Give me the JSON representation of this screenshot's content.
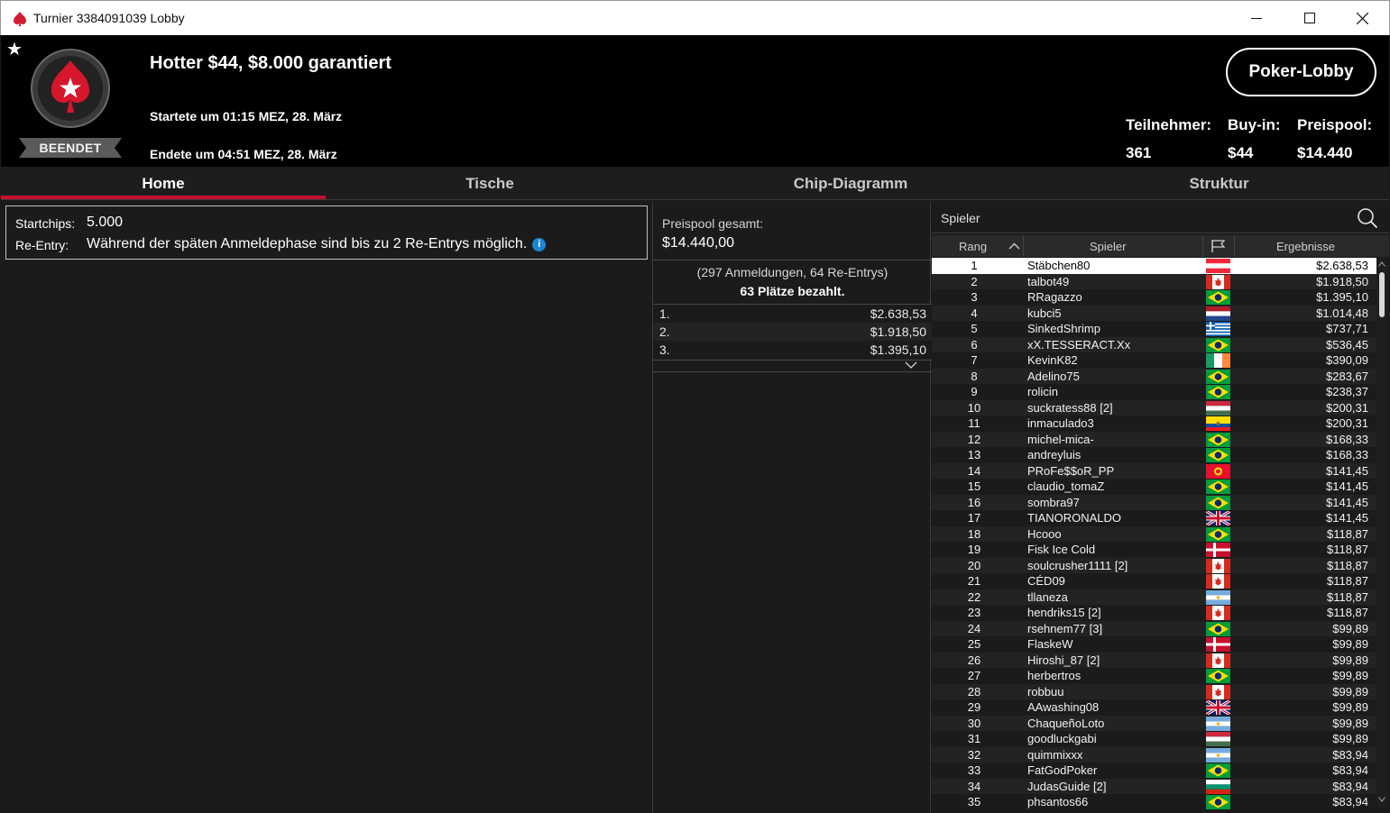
{
  "window": {
    "title": "Turnier 3384091039 Lobby"
  },
  "header": {
    "tournament_name": "Hotter $44, $8.000 garantiert",
    "started": "Startete um 01:15 MEZ, 28. März",
    "ended": "Endete um 04:51 MEZ, 28. März",
    "status": "BEENDET",
    "lobby_button": "Poker-Lobby",
    "stats": [
      {
        "label": "Teilnehmer:",
        "value": "361"
      },
      {
        "label": "Buy-in:",
        "value": "$44"
      },
      {
        "label": "Preispool:",
        "value": "$14.440"
      }
    ]
  },
  "tabs": [
    {
      "label": "Home",
      "active": true
    },
    {
      "label": "Tische",
      "active": false
    },
    {
      "label": "Chip-Diagramm",
      "active": false
    },
    {
      "label": "Struktur",
      "active": false
    }
  ],
  "info": {
    "startchips_label": "Startchips:",
    "startchips_value": "5.000",
    "reentry_label": "Re-Entry:",
    "reentry_value": "Während der späten Anmeldephase sind bis zu 2 Re-Entrys möglich.",
    "info_icon_glyph": "i"
  },
  "prizepool": {
    "label": "Preispool gesamt:",
    "total": "$14.440,00",
    "entries": "(297 Anmeldungen, 64 Re-Entrys)",
    "paid": "63 Plätze bezahlt.",
    "payouts": [
      {
        "place": "1.",
        "amount": "$2.638,53"
      },
      {
        "place": "2.",
        "amount": "$1.918,50"
      },
      {
        "place": "3.",
        "amount": "$1.395,10"
      }
    ]
  },
  "players": {
    "search_label": "Spieler",
    "columns": {
      "rank": "Rang",
      "player": "Spieler",
      "result": "Ergebnisse"
    },
    "rows": [
      {
        "rank": "1",
        "name": "Stäbchen80",
        "flag": "austria",
        "amount": "$2.638,53"
      },
      {
        "rank": "2",
        "name": "talbot49",
        "flag": "canada",
        "amount": "$1.918,50"
      },
      {
        "rank": "3",
        "name": "RRagazzo",
        "flag": "brazil",
        "amount": "$1.395,10"
      },
      {
        "rank": "4",
        "name": "kubci5",
        "flag": "netherlands",
        "amount": "$1.014,48"
      },
      {
        "rank": "5",
        "name": "SinkedShrimp",
        "flag": "greece",
        "amount": "$737,71"
      },
      {
        "rank": "6",
        "name": "xX.TESSERACT.Xx",
        "flag": "brazil",
        "amount": "$536,45"
      },
      {
        "rank": "7",
        "name": "KevinK82",
        "flag": "ireland",
        "amount": "$390,09"
      },
      {
        "rank": "8",
        "name": "Adelino75",
        "flag": "brazil",
        "amount": "$283,67"
      },
      {
        "rank": "9",
        "name": "rolicin",
        "flag": "brazil",
        "amount": "$238,37"
      },
      {
        "rank": "10",
        "name": "suckratess88 [2]",
        "flag": "hungary",
        "amount": "$200,31"
      },
      {
        "rank": "11",
        "name": "inmaculado3",
        "flag": "ecuador",
        "amount": "$200,31"
      },
      {
        "rank": "12",
        "name": "michel-mica-",
        "flag": "brazil",
        "amount": "$168,33"
      },
      {
        "rank": "13",
        "name": "andreyluis",
        "flag": "brazil",
        "amount": "$168,33"
      },
      {
        "rank": "14",
        "name": "PRoFe$$oR_PP",
        "flag": "kyrgyzstan",
        "amount": "$141,45"
      },
      {
        "rank": "15",
        "name": "claudio_tomaZ",
        "flag": "brazil",
        "amount": "$141,45"
      },
      {
        "rank": "16",
        "name": "sombra97",
        "flag": "brazil",
        "amount": "$141,45"
      },
      {
        "rank": "17",
        "name": "TIANORONALDO",
        "flag": "uk",
        "amount": "$141,45"
      },
      {
        "rank": "18",
        "name": "Hcooo",
        "flag": "brazil",
        "amount": "$118,87"
      },
      {
        "rank": "19",
        "name": "Fisk Ice Cold",
        "flag": "denmark",
        "amount": "$118,87"
      },
      {
        "rank": "20",
        "name": "soulcrusher1111 [2]",
        "flag": "canada",
        "amount": "$118,87"
      },
      {
        "rank": "21",
        "name": "CÉD09",
        "flag": "canada",
        "amount": "$118,87"
      },
      {
        "rank": "22",
        "name": "tllaneza",
        "flag": "argentina",
        "amount": "$118,87"
      },
      {
        "rank": "23",
        "name": "hendriks15 [2]",
        "flag": "canada",
        "amount": "$118,87"
      },
      {
        "rank": "24",
        "name": "rsehnem77 [3]",
        "flag": "brazil",
        "amount": "$99,89"
      },
      {
        "rank": "25",
        "name": "FlaskeW",
        "flag": "denmark",
        "amount": "$99,89"
      },
      {
        "rank": "26",
        "name": "Hiroshi_87 [2]",
        "flag": "canada",
        "amount": "$99,89"
      },
      {
        "rank": "27",
        "name": "herbertros",
        "flag": "brazil",
        "amount": "$99,89"
      },
      {
        "rank": "28",
        "name": "robbuu",
        "flag": "canada",
        "amount": "$99,89"
      },
      {
        "rank": "29",
        "name": "AAwashing08",
        "flag": "uk",
        "amount": "$99,89"
      },
      {
        "rank": "30",
        "name": "ChaqueñoLoto",
        "flag": "argentina",
        "amount": "$99,89"
      },
      {
        "rank": "31",
        "name": "goodluckgabi",
        "flag": "hungary",
        "amount": "$99,89"
      },
      {
        "rank": "32",
        "name": "quimmixxx",
        "flag": "argentina",
        "amount": "$83,94"
      },
      {
        "rank": "33",
        "name": "FatGodPoker",
        "flag": "brazil",
        "amount": "$83,94"
      },
      {
        "rank": "34",
        "name": "JudasGuide [2]",
        "flag": "bulgaria",
        "amount": "$83,94"
      },
      {
        "rank": "35",
        "name": "phsantos66",
        "flag": "brazil",
        "amount": "$83,94"
      }
    ]
  },
  "colors": {
    "accent_red": "#c8102e",
    "background": "#1b1b1b",
    "header_bg": "#000000",
    "info_blue": "#1b87d6"
  }
}
